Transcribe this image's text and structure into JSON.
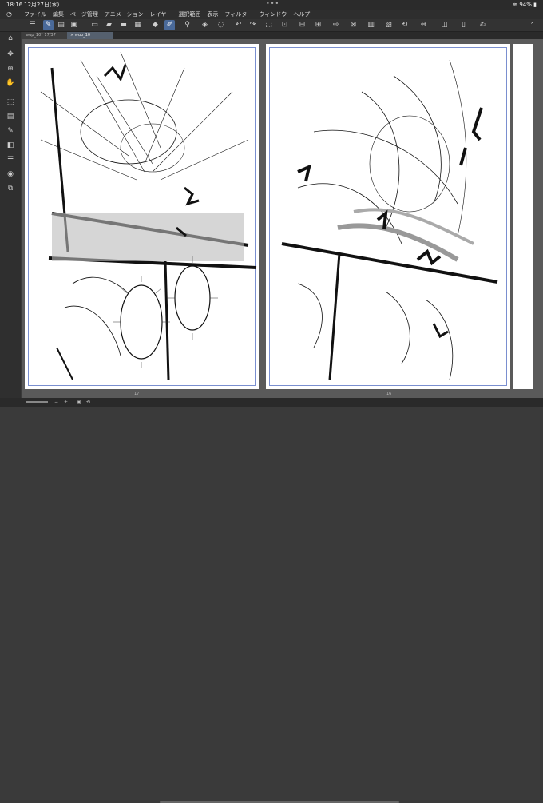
{
  "status": {
    "time": "18:16",
    "date": "12月27日(水)",
    "battery": "94%"
  },
  "menu": {
    "items": [
      "ファイル",
      "編集",
      "ページ管理",
      "アニメーション",
      "レイヤー",
      "選択範囲",
      "表示",
      "フィルター",
      "ウィンドウ",
      "ヘルプ"
    ]
  },
  "tabs": [
    {
      "label": "wup_10°  17/37"
    },
    {
      "label": "× wup_10"
    }
  ],
  "pages": {
    "left_number": "17",
    "right_number": "16"
  },
  "colors": {
    "accent": "#4a6a9a",
    "frame": "#7a8fd0"
  }
}
